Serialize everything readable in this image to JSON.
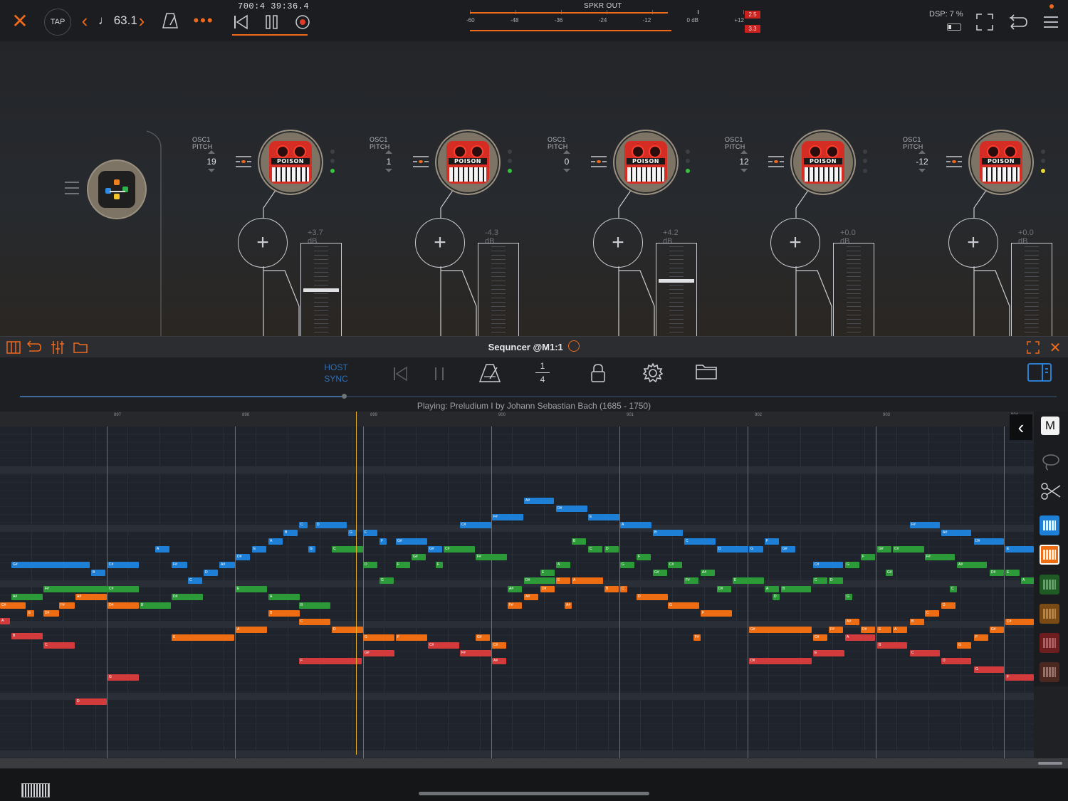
{
  "topbar": {
    "tap_label": "TAP",
    "tempo": "♩ 63.1",
    "position": "700:4   39:36.4",
    "meter_title": "SPKR OUT",
    "meter_scale": [
      "-60",
      "-48",
      "-36",
      "-24",
      "-12",
      "0 dB",
      "+12"
    ],
    "peak_top": "2.5",
    "peak_bottom": "3.3",
    "dsp": "DSP:  7 %"
  },
  "channels": [
    {
      "label": "OSC1 PITCH",
      "pitch": "19",
      "gain": "+3.7 dB",
      "fader_level": 0.5,
      "plugin": "POISON"
    },
    {
      "label": "OSC1 PITCH",
      "pitch": "1",
      "gain": "-4.3 dB",
      "fader_level": 0.0,
      "plugin": "POISON"
    },
    {
      "label": "OSC1 PITCH",
      "pitch": "0",
      "gain": "+4.2 dB",
      "fader_level": 0.6,
      "plugin": "POISON"
    },
    {
      "label": "OSC1 PITCH",
      "pitch": "12",
      "gain": "+0.0 dB",
      "fader_level": 0.0,
      "plugin": "POISON"
    },
    {
      "label": "OSC1 PITCH",
      "pitch": "-12",
      "gain": "+0.0 dB",
      "fader_level": 0.0,
      "plugin": "POISON"
    }
  ],
  "sequencer": {
    "title": "Sequncer @M1:1",
    "host_sync": "HOST\nSYNC",
    "quant_top": "1",
    "quant_bottom": "4",
    "playing": "Playing: Preludium I by Johann Sebastian Bach (1685 - 1750)",
    "bars": [
      "897",
      "898",
      "899",
      "900",
      "901",
      "902",
      "903",
      "904"
    ],
    "mode_button": "M"
  },
  "colors": {
    "accent": "#f06a1c",
    "blue_note": "#1e7fd6",
    "green_note": "#2c9a38",
    "orange_note": "#ee6c12",
    "red_note": "#d23a3b",
    "playhead": "#e6b02b"
  }
}
